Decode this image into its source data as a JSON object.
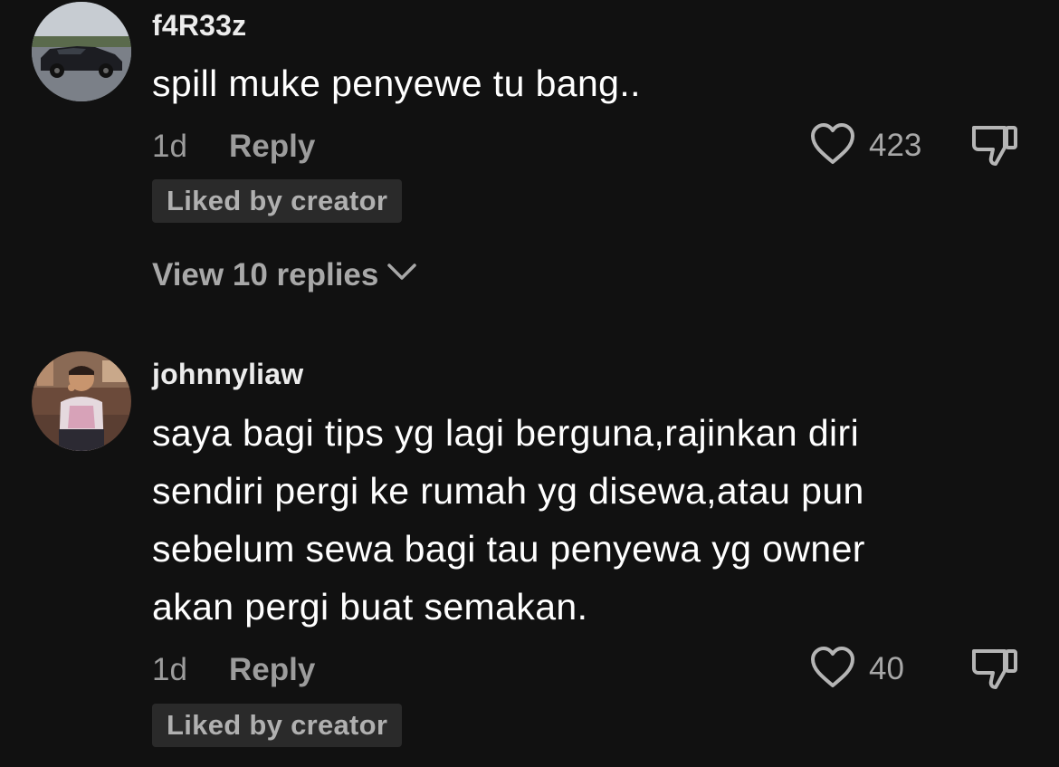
{
  "comments": [
    {
      "username": "f4R33z",
      "text": "spill muke penyewe tu bang..",
      "time": "1d",
      "reply_label": "Reply",
      "like_count": "423",
      "liked_badge": "Liked by creator",
      "view_replies": "View 10 replies"
    },
    {
      "username": "johnnyliaw",
      "text_lines": [
        "saya bagi tips yg lagi berguna,rajinkan diri",
        "sendiri pergi ke rumah yg disewa,atau pun",
        "sebelum sewa bagi tau penyewa yg owner",
        "akan pergi buat semakan."
      ],
      "time": "1d",
      "reply_label": "Reply",
      "like_count": "40",
      "liked_badge": "Liked by creator"
    }
  ],
  "icons": {
    "like": "heart-outline-icon",
    "dislike": "thumbs-down-icon",
    "expand": "chevron-down-icon"
  },
  "colors": {
    "background": "#111111",
    "text_primary": "#ffffff",
    "text_secondary": "#9c9c9c",
    "badge_bg": "#2a2a2a"
  }
}
